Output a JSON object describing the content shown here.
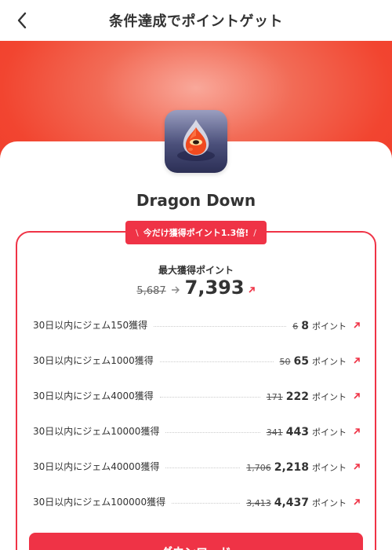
{
  "header": {
    "title": "条件達成でポイントゲット"
  },
  "app": {
    "name": "Dragon Down"
  },
  "promo": {
    "label": "今だけ獲得ポイント1.3倍!",
    "slash_left": "\\",
    "slash_right": "/"
  },
  "max_points": {
    "label": "最大獲得ポイント",
    "old": "5,687",
    "new": "7,393"
  },
  "tasks": [
    {
      "label": "30日以内にジェム150獲得",
      "old": "6",
      "new": "8",
      "unit": "ポイント"
    },
    {
      "label": "30日以内にジェム1000獲得",
      "old": "50",
      "new": "65",
      "unit": "ポイント"
    },
    {
      "label": "30日以内にジェム4000獲得",
      "old": "171",
      "new": "222",
      "unit": "ポイント"
    },
    {
      "label": "30日以内にジェム10000獲得",
      "old": "341",
      "new": "443",
      "unit": "ポイント"
    },
    {
      "label": "30日以内にジェム40000獲得",
      "old": "1,706",
      "new": "2,218",
      "unit": "ポイント"
    },
    {
      "label": "30日以内にジェム100000獲得",
      "old": "3,413",
      "new": "4,437",
      "unit": "ポイント"
    }
  ],
  "download": {
    "label": "ダウンロード"
  },
  "colors": {
    "accent": "#ef3346",
    "hero": "#f24530"
  }
}
